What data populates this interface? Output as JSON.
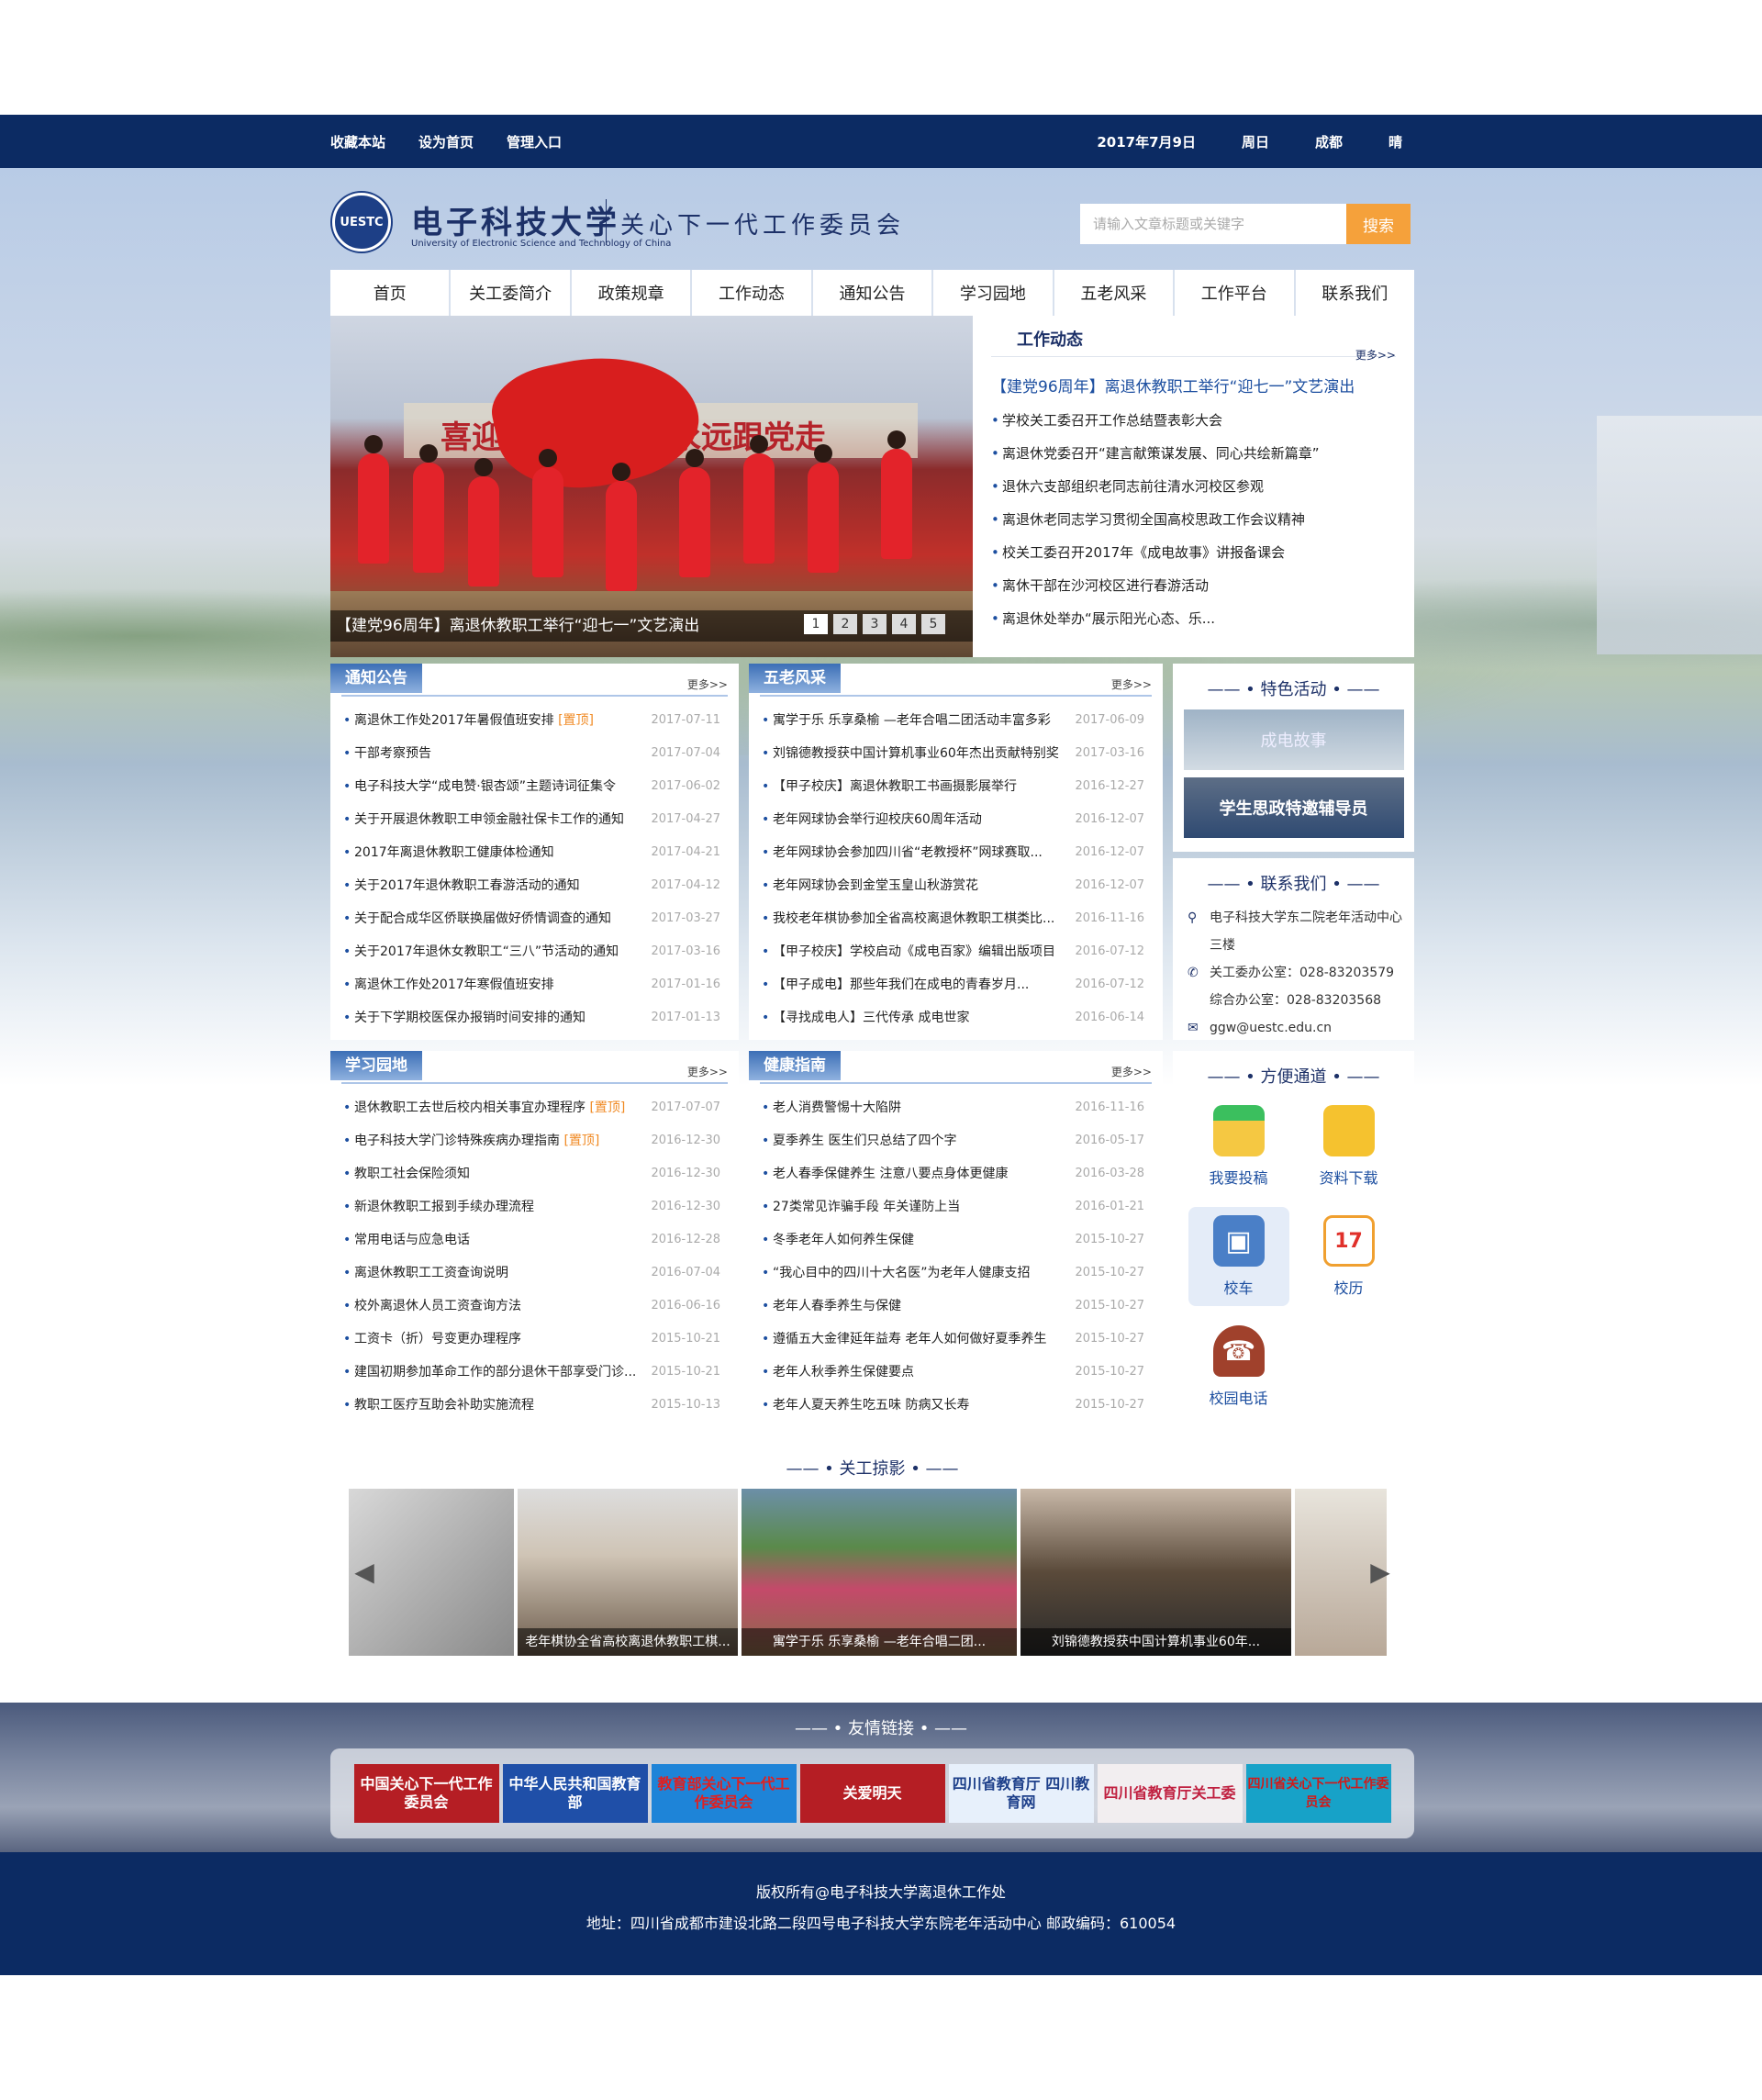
{
  "topbar": {
    "links": [
      "收藏本站",
      "设为首页",
      "管理入口"
    ],
    "date": "2017年7月9日",
    "weekday": "周日",
    "city": "成都",
    "weather": "晴"
  },
  "header": {
    "logo_badge": "UESTC",
    "school_name": "电子科技大学",
    "school_name_en": "University of Electronic Science and Technology of China",
    "committee": "关心下一代工作委员会",
    "search_placeholder": "请输入文章标题或关键字",
    "search_button": "搜索"
  },
  "nav": [
    "首页",
    "关工委简介",
    "政策规章",
    "工作动态",
    "通知公告",
    "学习园地",
    "五老风采",
    "工作平台",
    "联系我们"
  ],
  "slider": {
    "banner_left": "喜迎",
    "banner_right": "永远跟党走",
    "caption": "【建党96周年】离退休教职工举行“迎七一”文艺演出",
    "pages": [
      "1",
      "2",
      "3",
      "4",
      "5"
    ]
  },
  "work_news": {
    "title": "工作动态",
    "more": "更多>>",
    "headline": "【建党96周年】离退休教职工举行“迎七一”文艺演出",
    "items": [
      "学校关工委召开工作总结暨表彰大会",
      "离退休党委召开“建言献策谋发展、同心共绘新篇章”",
      "退休六支部组织老同志前往清水河校区参观",
      "离退休老同志学习贯彻全国高校思政工作会议精神",
      "校关工委召开2017年《成电故事》讲报备课会",
      "离休干部在沙河校区进行春游活动",
      "离退休处举办“展示阳光心态、乐..."
    ]
  },
  "notices": {
    "title": "通知公告",
    "more": "更多>>",
    "pin": "[置顶]",
    "items": [
      {
        "text": "离退休工作处2017年暑假值班安排",
        "date": "2017-07-11",
        "pinned": true
      },
      {
        "text": "干部考察预告",
        "date": "2017-07-04"
      },
      {
        "text": "电子科技大学“成电赞·银杏颂”主题诗词征集令",
        "date": "2017-06-02"
      },
      {
        "text": "关于开展退休教职工申领金融社保卡工作的通知",
        "date": "2017-04-27"
      },
      {
        "text": "2017年离退休教职工健康体检通知",
        "date": "2017-04-21"
      },
      {
        "text": "关于2017年退休教职工春游活动的通知",
        "date": "2017-04-12"
      },
      {
        "text": "关于配合成华区侨联换届做好侨情调查的通知",
        "date": "2017-03-27"
      },
      {
        "text": "关于2017年退休女教职工“三八”节活动的通知",
        "date": "2017-03-16"
      },
      {
        "text": "离退休工作处2017年寒假值班安排",
        "date": "2017-01-16"
      },
      {
        "text": "关于下学期校医保办报销时间安排的通知",
        "date": "2017-01-13"
      }
    ]
  },
  "wulao": {
    "title": "五老风采",
    "more": "更多>>",
    "items": [
      {
        "text": "寓学于乐 乐享桑榆 —老年合唱二团活动丰富多彩",
        "date": "2017-06-09"
      },
      {
        "text": "刘锦德教授获中国计算机事业60年杰出贡献特别奖",
        "date": "2017-03-16"
      },
      {
        "text": "【甲子校庆】离退休教职工书画摄影展举行",
        "date": "2016-12-27"
      },
      {
        "text": "老年网球协会举行迎校庆60周年活动",
        "date": "2016-12-07"
      },
      {
        "text": "老年网球协会参加四川省“老教授杯”网球赛取...",
        "date": "2016-12-07"
      },
      {
        "text": "老年网球协会到金堂玉皇山秋游赏花",
        "date": "2016-12-07"
      },
      {
        "text": "我校老年棋协参加全省高校离退休教职工棋类比...",
        "date": "2016-11-16"
      },
      {
        "text": "【甲子校庆】学校启动《成电百家》编辑出版项目",
        "date": "2016-07-12"
      },
      {
        "text": "【甲子成电】那些年我们在成电的青春岁月...",
        "date": "2016-07-12"
      },
      {
        "text": "【寻找成电人】三代传承 成电世家",
        "date": "2016-06-14"
      }
    ]
  },
  "featured": {
    "title": "特色活动",
    "items": [
      "成电故事",
      "学生思政特邀辅导员"
    ]
  },
  "contact": {
    "title": "联系我们",
    "address": "电子科技大学东二院老年活动中心三楼",
    "phone1": "关工委办公室：028-83203579",
    "phone2": "综合办公室：028-83203568",
    "email": "ggw@uestc.edu.cn"
  },
  "study": {
    "title": "学习园地",
    "more": "更多>>",
    "pin": "[置顶]",
    "items": [
      {
        "text": "退休教职工去世后校内相关事宜办理程序",
        "date": "2017-07-07",
        "pinned": true
      },
      {
        "text": "电子科技大学门诊特殊疾病办理指南",
        "date": "2016-12-30",
        "pinned": true
      },
      {
        "text": "教职工社会保险须知",
        "date": "2016-12-30"
      },
      {
        "text": "新退休教职工报到手续办理流程",
        "date": "2016-12-30"
      },
      {
        "text": "常用电话与应急电话",
        "date": "2016-12-28"
      },
      {
        "text": "离退休教职工工资查询说明",
        "date": "2016-07-04"
      },
      {
        "text": "校外离退休人员工资查询方法",
        "date": "2016-06-16"
      },
      {
        "text": "工资卡（折）号变更办理程序",
        "date": "2015-10-21"
      },
      {
        "text": "建国初期参加革命工作的部分退休干部享受门诊...",
        "date": "2015-10-21"
      },
      {
        "text": "教职工医疗互助会补助实施流程",
        "date": "2015-10-13"
      }
    ]
  },
  "health": {
    "title": "健康指南",
    "more": "更多>>",
    "items": [
      {
        "text": "老人消费警惕十大陷阱",
        "date": "2016-11-16"
      },
      {
        "text": "夏季养生 医生们只总结了四个字",
        "date": "2016-05-17"
      },
      {
        "text": "老人春季保健养生 注意八要点身体更健康",
        "date": "2016-03-28"
      },
      {
        "text": "27类常见诈骗手段 年关谨防上当",
        "date": "2016-01-21"
      },
      {
        "text": "冬季老年人如何养生保健",
        "date": "2015-10-27"
      },
      {
        "text": "“我心目中的四川十大名医”为老年人健康支招",
        "date": "2015-10-27"
      },
      {
        "text": "老年人春季养生与保健",
        "date": "2015-10-27"
      },
      {
        "text": "遵循五大金律延年益寿 老年人如何做好夏季养生",
        "date": "2015-10-27"
      },
      {
        "text": "老年人秋季养生保健要点",
        "date": "2015-10-27"
      },
      {
        "text": "老年人夏天养生吃五味 防病又长寿",
        "date": "2015-10-27"
      }
    ]
  },
  "quick": {
    "title": "方便通道",
    "items": [
      "我要投稿",
      "资料下载",
      "校车",
      "校历",
      "校园电话"
    ],
    "calendar_day": "17"
  },
  "gallery": {
    "title": "关工掠影",
    "captions": [
      "老年棋协全省高校离退休教职工棋...",
      "寓学于乐 乐享桑榆 —老年合唱二团...",
      "刘锦德教授获中国计算机事业60年..."
    ]
  },
  "friend_links": {
    "title": "友情链接",
    "items": [
      "中国关心下一代工作委员会",
      "中华人民共和国教育部",
      "教育部关心下一代工作委员会",
      "关爱明天",
      "四川省教育厅 四川教育网",
      "四川省教育厅关工委",
      "四川省关心下一代工作委员会"
    ]
  },
  "footer": {
    "copyright": "版权所有@电子科技大学离退休工作处",
    "address": "地址：四川省成都市建设北路二段四号电子科技大学东院老年活动中心    邮政编码：610054"
  },
  "colors": {
    "navy": "#0c2b63",
    "accent_orange": "#f5a13b",
    "link_blue": "#1d4fa0"
  }
}
